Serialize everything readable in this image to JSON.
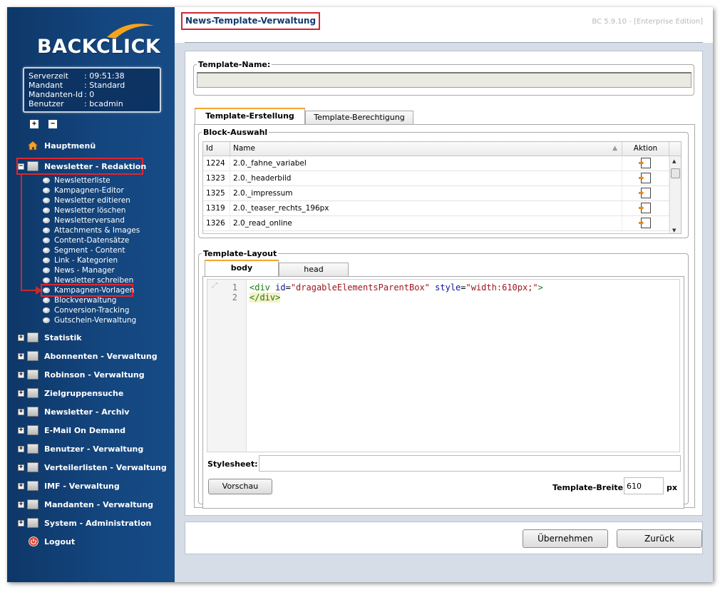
{
  "brand": {
    "logo_text": "BACKCLICK"
  },
  "server_info": [
    {
      "key": "Serverzeit",
      "value": ": 09:51:38"
    },
    {
      "key": "Mandant",
      "value": ": Standard"
    },
    {
      "key": "Mandanten-Id",
      "value": ": 0"
    },
    {
      "key": "Benutzer",
      "value": ": bcadmin"
    }
  ],
  "sidebar": {
    "expand_all": "+",
    "collapse_all": "−",
    "home": "Hauptmenü",
    "active_section": "Newsletter - Redaktion",
    "sub_items": [
      "Newsletterliste",
      "Kampagnen-Editor",
      "Newsletter editieren",
      "Newsletter löschen",
      "Newsletterversand",
      "Attachments & Images",
      "Content-Datensätze",
      "Segment - Content",
      "Link - Kategorien",
      "News - Manager",
      "Newsletter schreiben",
      "Kampagnen-Vorlagen",
      "Blockverwaltung",
      "Conversion-Tracking",
      "Gutschein-Verwaltung"
    ],
    "sections": [
      "Statistik",
      "Abonnenten - Verwaltung",
      "Robinson - Verwaltung",
      "Zielgruppensuche",
      "Newsletter - Archiv",
      "E-Mail On Demand",
      "Benutzer - Verwaltung",
      "Verteilerlisten - Verwaltung",
      "IMF - Verwaltung",
      "Mandanten - Verwaltung",
      "System - Administration"
    ],
    "logout": "Logout"
  },
  "header": {
    "title": "News-Template-Verwaltung",
    "version": "BC 5.9.10 - [Enterprise Edition]"
  },
  "template_name": {
    "legend": "Template-Name:",
    "value": ""
  },
  "tabs": [
    "Template-Erstellung",
    "Template-Berechtigung"
  ],
  "block_selection": {
    "legend": "Block-Auswahl",
    "columns": [
      "Id",
      "Name",
      "Aktion"
    ],
    "rows": [
      {
        "id": "1224",
        "name": "2.0._fahne_variabel"
      },
      {
        "id": "1323",
        "name": "2.0._headerbild"
      },
      {
        "id": "1325",
        "name": "2.0._impressum"
      },
      {
        "id": "1319",
        "name": "2.0._teaser_rechts_196px"
      },
      {
        "id": "1326",
        "name": "2.0_read_online"
      }
    ]
  },
  "template_layout": {
    "legend": "Template-Layout",
    "tabs": [
      "body",
      "head"
    ],
    "line_numbers": [
      "1",
      "2"
    ],
    "code": {
      "l1_open": "<div",
      "l1_attr1": "id",
      "l1_val1": "\"dragableElementsParentBox\"",
      "l1_attr2": "style",
      "l1_val2": "\"width:610px;\"",
      "l1_close": ">",
      "l2": "</div>"
    },
    "stylesheet_label": "Stylesheet:",
    "stylesheet_value": "",
    "preview_button": "Vorschau",
    "width_label": "Template-Breite:",
    "width_value": "610",
    "width_unit": "px"
  },
  "actions": {
    "apply": "Übernehmen",
    "back": "Zurück"
  },
  "colors": {
    "sidebar": "#14467f",
    "highlight": "#e0262e",
    "title": "#123b6e"
  }
}
